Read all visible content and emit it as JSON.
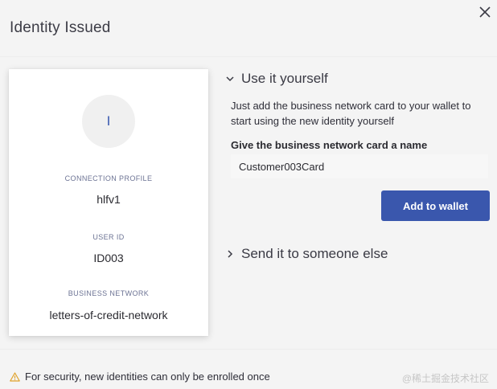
{
  "dialog": {
    "title": "Identity Issued",
    "close_icon": "close-icon"
  },
  "card": {
    "avatar_initial": "I",
    "fields": [
      {
        "label": "CONNECTION PROFILE",
        "value": "hlfv1"
      },
      {
        "label": "USER ID",
        "value": "ID003"
      },
      {
        "label": "BUSINESS NETWORK",
        "value": "letters-of-credit-network"
      }
    ]
  },
  "use_yourself": {
    "header": "Use it yourself",
    "expanded": true,
    "chevron_icon": "chevron-down-icon",
    "description": "Just add the business network card to your wallet to start using the new identity yourself",
    "name_label": "Give the business network card a name",
    "name_value": "Customer003Card",
    "add_button": "Add to wallet"
  },
  "send_someone": {
    "header": "Send it to someone else",
    "expanded": false,
    "chevron_icon": "chevron-right-icon"
  },
  "footer": {
    "warning_icon": "warning-icon",
    "message": "For security, new identities can only be enrolled once"
  },
  "watermark": "@稀土掘金技术社区",
  "colors": {
    "accent": "#3a57ad",
    "background": "#f4f4f4",
    "warning": "#e0a22a"
  }
}
